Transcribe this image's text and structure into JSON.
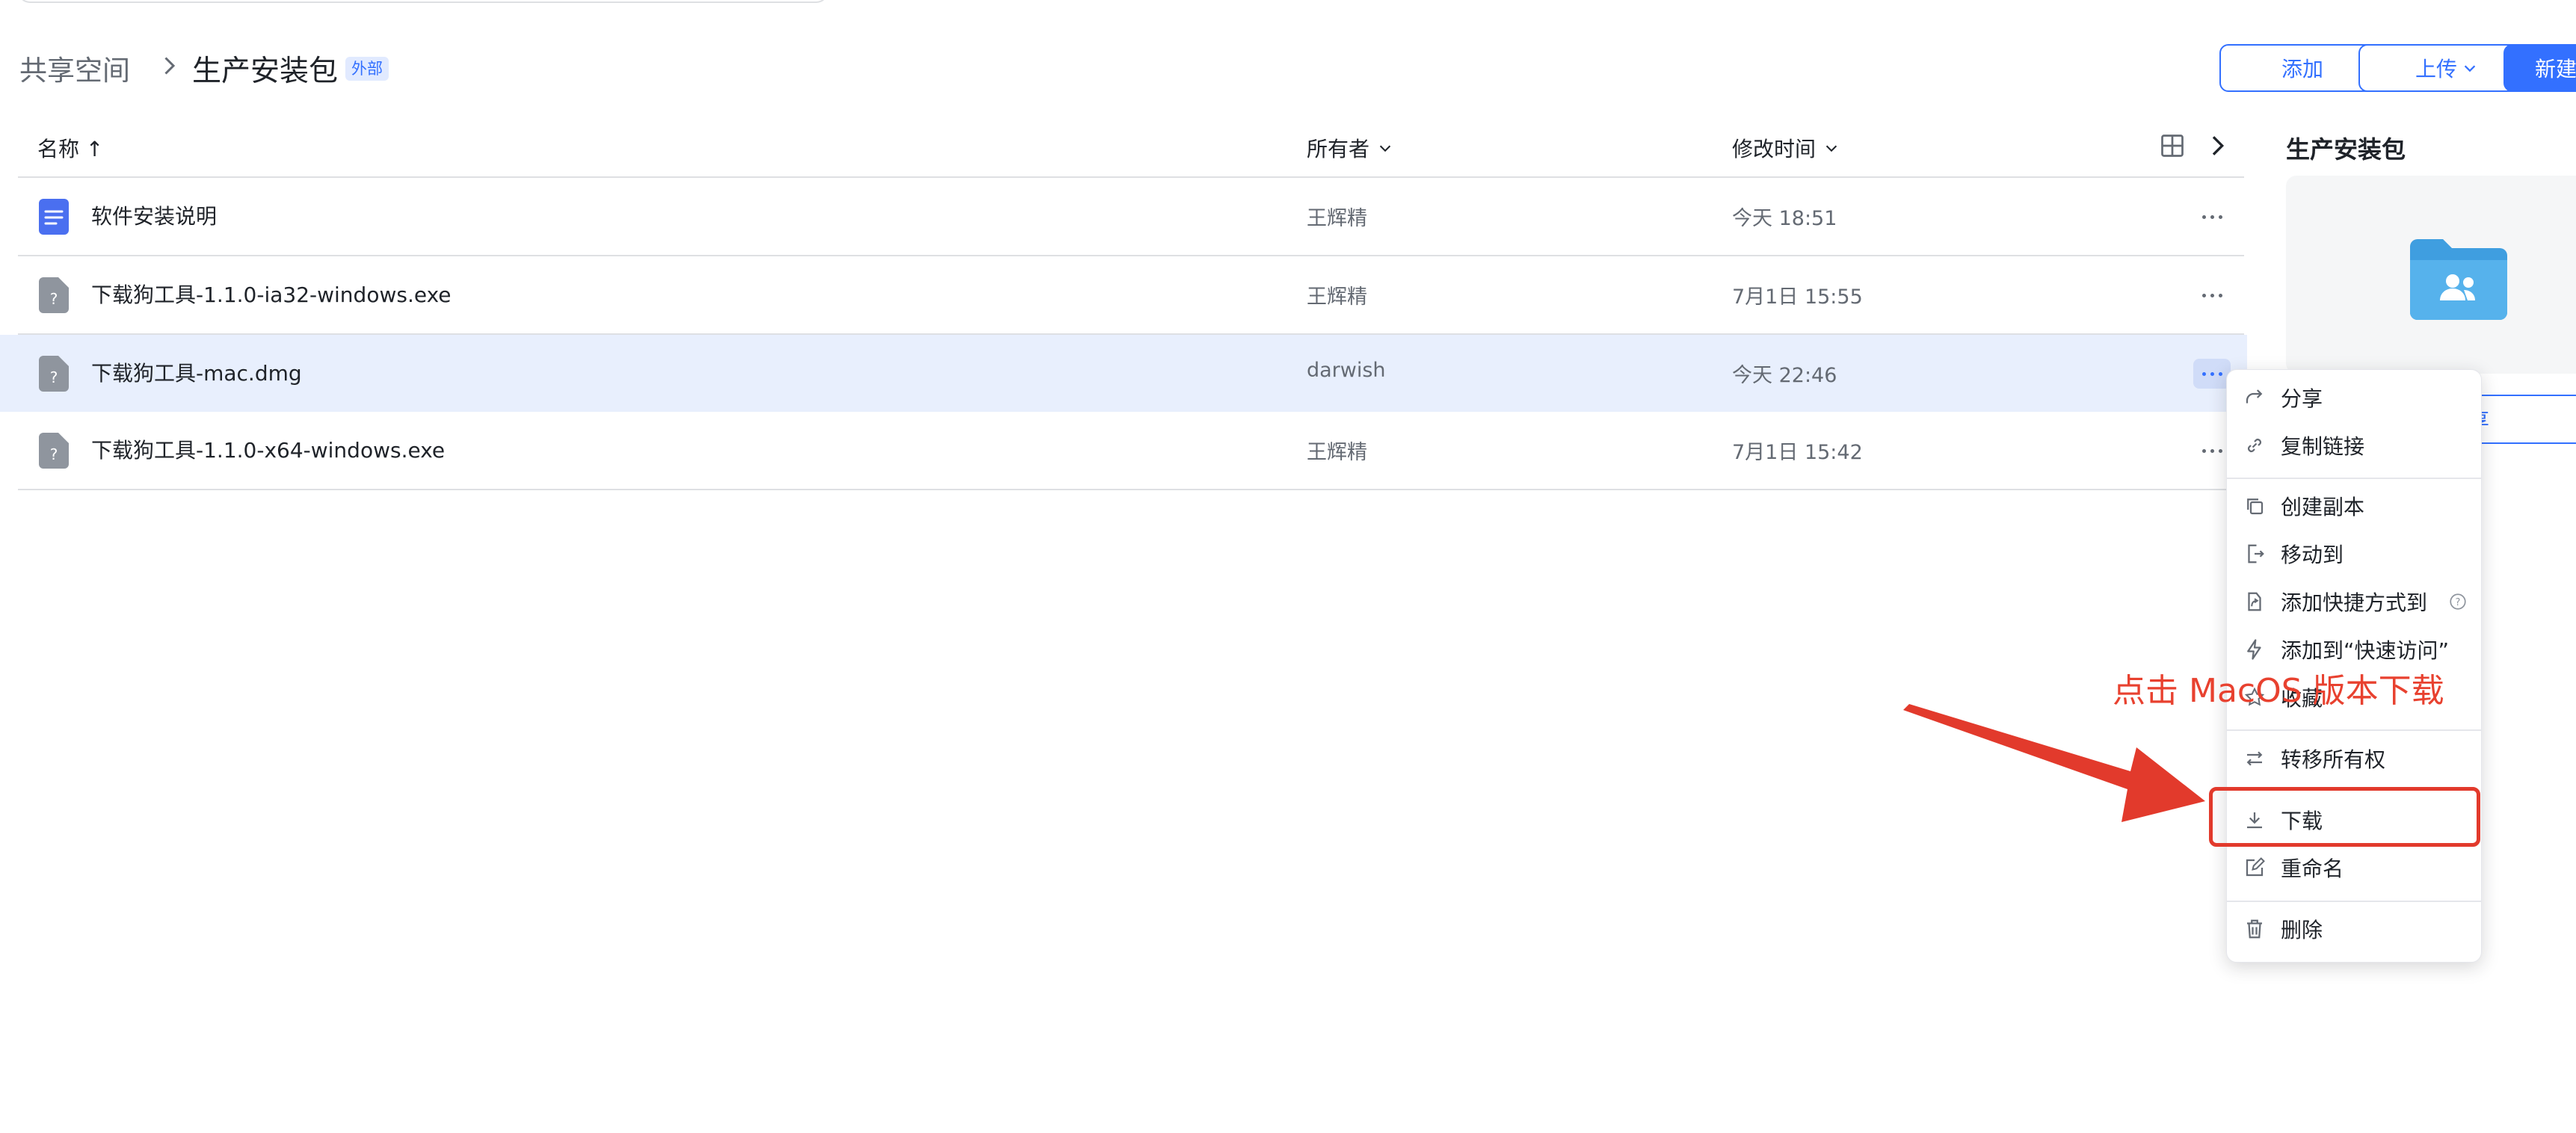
{
  "breadcrumb": {
    "root": "共享空间",
    "current": "生产安装包",
    "badge": "外部"
  },
  "toolbar": {
    "add_label": "添加",
    "upload_label": "上传",
    "new_label": "新建"
  },
  "table": {
    "headers": {
      "name": "名称 ↑",
      "owner": "所有者",
      "modified": "修改时间"
    },
    "rows": [
      {
        "name": "软件安装说明",
        "owner": "王辉精",
        "modified": "今天 18:51",
        "icon": "doc-icon"
      },
      {
        "name": "下载狗工具-1.1.0-ia32-windows.exe",
        "owner": "王辉精",
        "modified": "7月1日 15:55",
        "icon": "unknown-file-icon"
      },
      {
        "name": "下载狗工具-mac.dmg",
        "owner": "darwish",
        "modified": "今天 22:46",
        "icon": "unknown-file-icon"
      },
      {
        "name": "下载狗工具-1.1.0-x64-windows.exe",
        "owner": "王辉精",
        "modified": "7月1日 15:42",
        "icon": "unknown-file-icon"
      }
    ]
  },
  "right_panel": {
    "title": "生产安装包",
    "share_label": "享"
  },
  "context_menu": {
    "items": [
      {
        "label": "分享",
        "icon": "share-icon"
      },
      {
        "label": "复制链接",
        "icon": "link-icon"
      },
      {
        "label": "创建副本",
        "icon": "copy-icon"
      },
      {
        "label": "移动到",
        "icon": "move-icon"
      },
      {
        "label": "添加快捷方式到",
        "icon": "shortcut-icon"
      },
      {
        "label": "添加到“快速访问”",
        "icon": "lightning-icon"
      },
      {
        "label": "收藏",
        "icon": "star-icon"
      },
      {
        "label": "转移所有权",
        "icon": "transfer-icon"
      },
      {
        "label": "下载",
        "icon": "download-icon"
      },
      {
        "label": "重命名",
        "icon": "rename-icon"
      },
      {
        "label": "删除",
        "icon": "trash-icon"
      }
    ]
  },
  "annotation": {
    "text": "点击 MacOS 版本下载",
    "color": "#e8412f"
  },
  "colors": {
    "accent": "#3370ff",
    "selected_row": "#e8effd",
    "annotation_red": "#e23a2c"
  }
}
